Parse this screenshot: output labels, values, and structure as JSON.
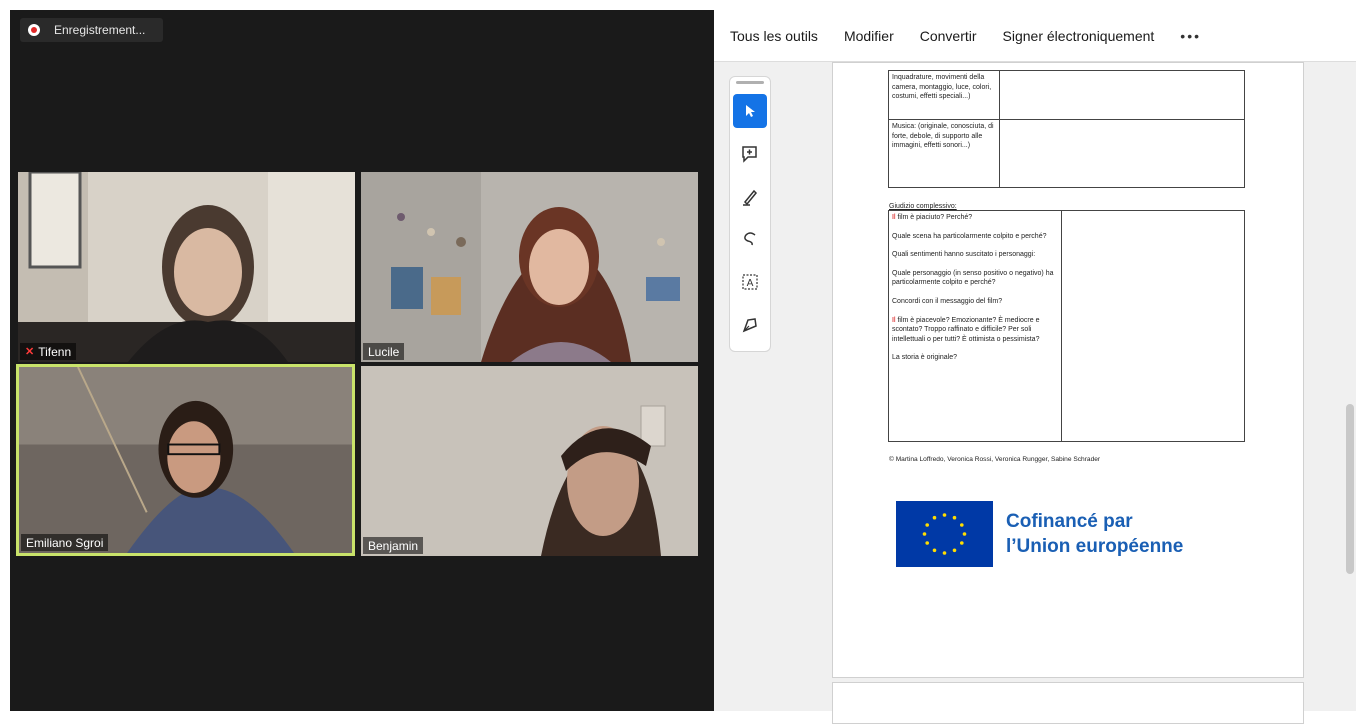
{
  "recording": {
    "label": "Enregistrement..."
  },
  "participants": [
    {
      "name": "Tifenn",
      "muted": true
    },
    {
      "name": "Lucile",
      "muted": false
    },
    {
      "name": "Emiliano Sgroi",
      "muted": false,
      "speaking": true
    },
    {
      "name": "Benjamin",
      "muted": false
    }
  ],
  "toolbar": {
    "items": [
      "Tous les outils",
      "Modifier",
      "Convertir",
      "Signer électroniquement"
    ],
    "more": "•••"
  },
  "tools": [
    "select-icon",
    "add-comment-icon",
    "highlight-pen-icon",
    "draw-freehand-icon",
    "text-box-icon",
    "sign-icon"
  ],
  "document": {
    "table1": [
      "Inquadrature, movimenti della camera, montaggio, luce, colori, costumi, effetti speciali...)",
      "Musica: (originale, conosciuta, di forte, debole, di supporto alle immagini, effetti sonori...)"
    ],
    "section_label": "Giudizio complessivo:",
    "questions": [
      {
        "lead": "Il",
        "text": " film è piaciuto? Perché?"
      },
      {
        "lead": "",
        "text": "Quale scena ha particolarmente colpito e perché?"
      },
      {
        "lead": "",
        "text": "Quali sentimenti hanno suscitato i personaggi:"
      },
      {
        "lead": "",
        "text": "Quale personaggio (in senso positivo o negativo) ha particolarmente colpito e perché?"
      },
      {
        "lead": "",
        "text": "Concordi con il messaggio del film?"
      },
      {
        "lead": "Il",
        "text": " film è piacevole? Emozionante? È mediocre e scontato? Troppo raffinato e difficile? Per soli intellettuali o per tutti? È ottimista o pessimista?"
      },
      {
        "lead": "",
        "text": "La storia è originale?"
      }
    ],
    "credit": "© Martina Loffredo, Veronica Rossi, Veronica Rungger, Sabine Schrader",
    "eu_line1": "Cofinancé par",
    "eu_line2": "l’Union européenne"
  },
  "colors": {
    "accent": "#1473e6",
    "speaking_border": "#c9e36a",
    "eu_blue": "#1a5fb4",
    "recording": "#e02828"
  }
}
